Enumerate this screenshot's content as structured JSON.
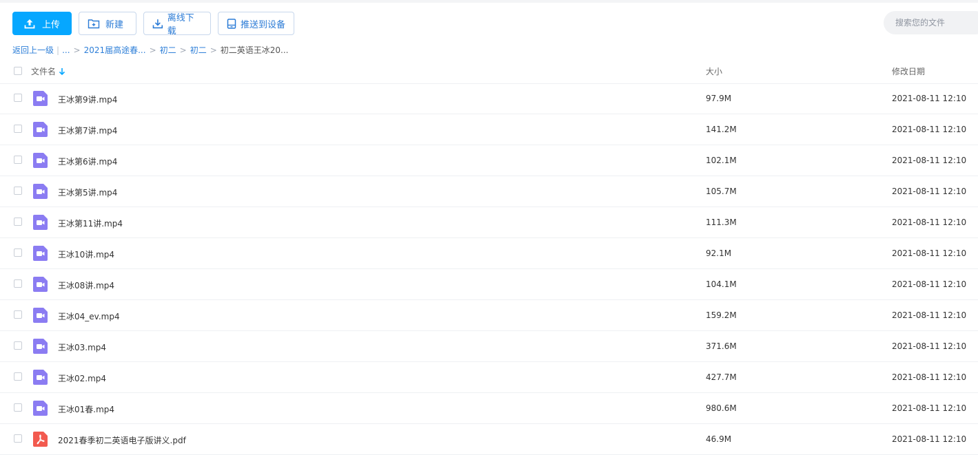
{
  "toolbar": {
    "upload": "上传",
    "new_folder": "新建",
    "offline_download": "离线下载",
    "push_device": "推送到设备"
  },
  "search": {
    "placeholder": "搜索您的文件"
  },
  "breadcrumb": {
    "back": "返回上一级",
    "sep": "|",
    "ellipsis": "...",
    "items": [
      "2021届高途春...",
      "初二",
      "初二"
    ],
    "current": "初二英语王冰20...",
    "arrow": ">"
  },
  "columns": {
    "name": "文件名",
    "size": "大小",
    "modified": "修改日期"
  },
  "colors": {
    "accent": "#06a7ff",
    "video_icon": "#8b7cf2",
    "pdf_icon": "#f25a4f",
    "link": "#2e7fd8"
  },
  "files": [
    {
      "name": "王冰第9讲.mp4",
      "size": "97.9M",
      "date": "2021-08-11 12:10",
      "icon": "video-file-icon"
    },
    {
      "name": "王冰第7讲.mp4",
      "size": "141.2M",
      "date": "2021-08-11 12:10",
      "icon": "video-file-icon"
    },
    {
      "name": "王冰第6讲.mp4",
      "size": "102.1M",
      "date": "2021-08-11 12:10",
      "icon": "video-file-icon"
    },
    {
      "name": "王冰第5讲.mp4",
      "size": "105.7M",
      "date": "2021-08-11 12:10",
      "icon": "video-file-icon"
    },
    {
      "name": "王冰第11讲.mp4",
      "size": "111.3M",
      "date": "2021-08-11 12:10",
      "icon": "video-file-icon"
    },
    {
      "name": "王冰10讲.mp4",
      "size": "92.1M",
      "date": "2021-08-11 12:10",
      "icon": "video-file-icon"
    },
    {
      "name": "王冰08讲.mp4",
      "size": "104.1M",
      "date": "2021-08-11 12:10",
      "icon": "video-file-icon"
    },
    {
      "name": "王冰04_ev.mp4",
      "size": "159.2M",
      "date": "2021-08-11 12:10",
      "icon": "video-file-icon"
    },
    {
      "name": "王冰03.mp4",
      "size": "371.6M",
      "date": "2021-08-11 12:10",
      "icon": "video-file-icon"
    },
    {
      "name": "王冰02.mp4",
      "size": "427.7M",
      "date": "2021-08-11 12:10",
      "icon": "video-file-icon"
    },
    {
      "name": "王冰01春.mp4",
      "size": "980.6M",
      "date": "2021-08-11 12:10",
      "icon": "video-file-icon"
    },
    {
      "name": "2021春季初二英语电子版讲义.pdf",
      "size": "46.9M",
      "date": "2021-08-11 12:10",
      "icon": "pdf-file-icon"
    }
  ]
}
